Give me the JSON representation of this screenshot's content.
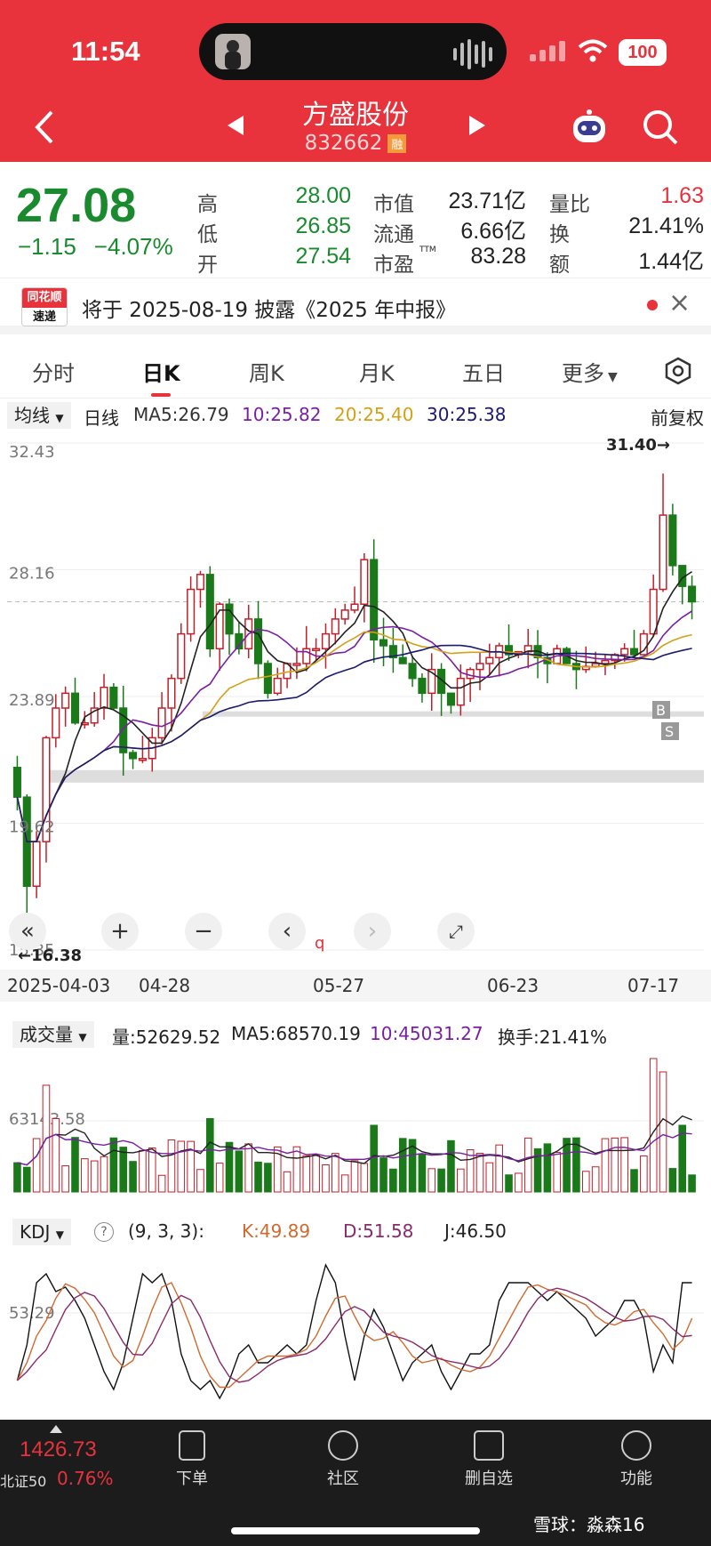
{
  "status": {
    "time": "11:54",
    "battery": "100"
  },
  "header": {
    "title": "方盛股份",
    "code": "832662",
    "badge": "融"
  },
  "quote": {
    "price": "27.08",
    "change": "−1.15",
    "pct": "−4.07%",
    "fields": [
      {
        "k": "高",
        "v": "28.00",
        "c": "#1a8a2e"
      },
      {
        "k": "市值",
        "v": "23.71亿",
        "c": "#222"
      },
      {
        "k": "量比",
        "v": "1.63",
        "c": "#e8323c"
      },
      {
        "k": "低",
        "v": "26.85",
        "c": "#1a8a2e"
      },
      {
        "k": "流通",
        "v": "6.66亿",
        "c": "#222"
      },
      {
        "k": "换",
        "v": "21.41%",
        "c": "#222"
      },
      {
        "k": "开",
        "v": "27.54",
        "c": "#1a8a2e"
      },
      {
        "k": "市盈",
        "sup": "TTM",
        "v": "83.28",
        "c": "#222"
      },
      {
        "k": "额",
        "v": "1.44亿",
        "c": "#222"
      }
    ]
  },
  "news": {
    "logo_top": "同花顺",
    "logo_bottom": "速递",
    "text": "将于 2025-08-19 披露《2025 年中报》",
    "close": "×"
  },
  "tabs": [
    "分时",
    "日K",
    "周K",
    "月K",
    "五日",
    "更多"
  ],
  "ma": {
    "selector": "均线",
    "period": "日线",
    "ma5": "MA5:26.79",
    "ma10": "10:25.82",
    "ma20": "20:25.40",
    "ma30": "30:25.38",
    "adjust": "前复权"
  },
  "kchart": {
    "y_labels": [
      "32.43",
      "28.16",
      "23.89",
      "19.62",
      "15.35"
    ],
    "high_mark": "31.40→",
    "low_mark": "←16.38",
    "x_labels": [
      "2025-04-03",
      "04-28",
      "05-27",
      "06-23",
      "07-17"
    ],
    "marker_b": "B",
    "marker_s": "S",
    "marker_q": "q"
  },
  "volume": {
    "selector": "成交量",
    "vol": "量:52629.52",
    "ma5": "MA5:68570.19",
    "ma10": "10:45031.27",
    "turnover": "换手:21.41%",
    "y_label": "63143.58"
  },
  "kdj": {
    "selector": "KDJ",
    "help": "?",
    "params": "(9, 3, 3):",
    "k": "K:49.89",
    "d": "D:51.58",
    "j": "J:46.50",
    "y_label": "53.29"
  },
  "bottom": {
    "index_value": "1426.73",
    "index_name": "北证50",
    "index_pct": "0.76%",
    "items": [
      "下单",
      "社区",
      "删自选",
      "功能"
    ]
  },
  "watermark": "雪球：淼森16",
  "chart_data": {
    "type": "candlestick",
    "title": "",
    "ylim": [
      15.35,
      32.43
    ],
    "x": [
      "2025-04-03",
      "04-28",
      "05-27",
      "06-23",
      "07-17"
    ],
    "series": [
      {
        "name": "MA5",
        "value": 26.79
      },
      {
        "name": "MA10",
        "value": 25.82
      },
      {
        "name": "MA20",
        "value": 25.4
      },
      {
        "name": "MA30",
        "value": 25.38
      }
    ],
    "high": 31.4,
    "low": 16.38,
    "close": 27.08,
    "colors": {
      "up": "#c0202a",
      "down": "#1a7a1a"
    }
  }
}
